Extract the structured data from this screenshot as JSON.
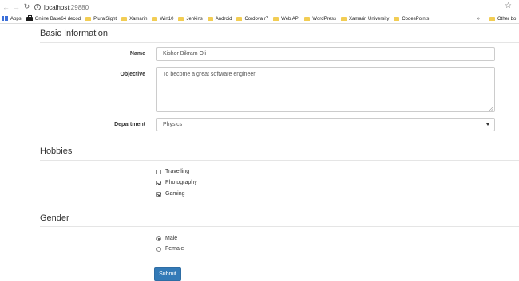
{
  "browser": {
    "url_host": "localhost",
    "url_port": ":29880",
    "bookmarks": {
      "apps_label": "Apps",
      "items": [
        "Online Base64 decod",
        "PluralSight",
        "Xamarin",
        "Win10",
        "Jenkins",
        "Android",
        "Cordova r7",
        "Web API",
        "WordPress",
        "Xamarin University",
        "CodesPoints"
      ],
      "more": "»",
      "other": "Other bo"
    }
  },
  "form": {
    "basic_title": "Basic Information",
    "name_label": "Name",
    "name_value": "Kishor Bikram Oli",
    "objective_label": "Objective",
    "objective_value": "To become a great software engineer",
    "department_label": "Department",
    "department_value": "Physics",
    "hobbies_title": "Hobbies",
    "hobbies": [
      {
        "label": "Travelling",
        "checked": false
      },
      {
        "label": "Photography",
        "checked": true
      },
      {
        "label": "Gaming",
        "checked": true
      }
    ],
    "gender_title": "Gender",
    "genders": [
      {
        "label": "Male",
        "selected": true
      },
      {
        "label": "Female",
        "selected": false
      }
    ],
    "submit_label": "Submit"
  },
  "colors": {
    "accent": "#337ab7",
    "folder": "#f2cd54"
  }
}
